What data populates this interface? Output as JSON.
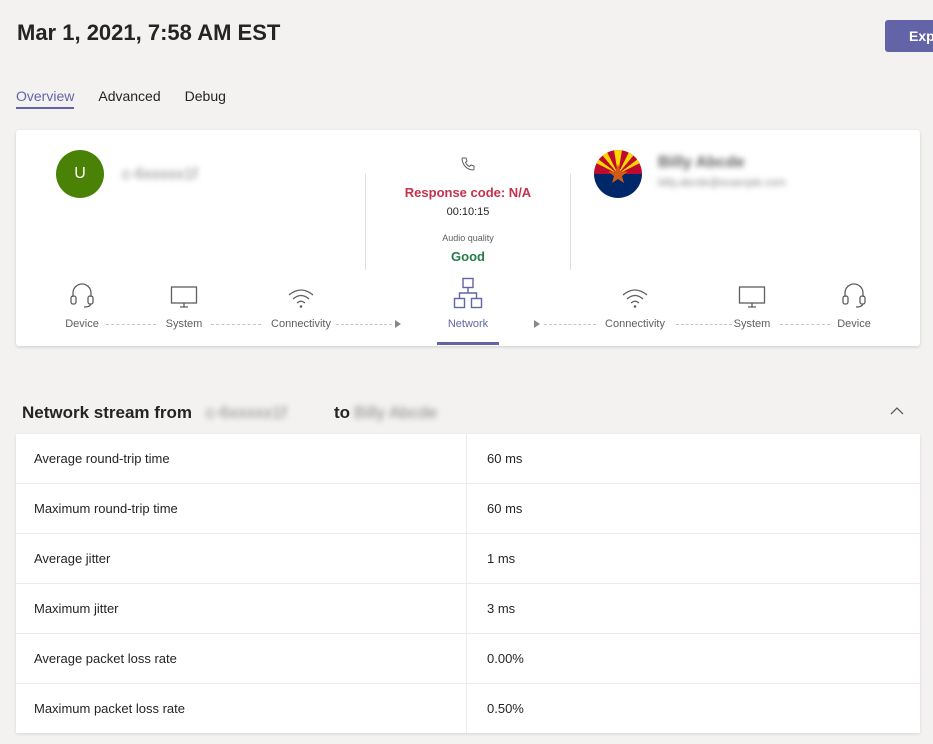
{
  "header": {
    "title": "Mar 1, 2021, 7:58 AM EST",
    "export_label": "Exp"
  },
  "tabs": [
    {
      "label": "Overview",
      "active": true
    },
    {
      "label": "Advanced",
      "active": false
    },
    {
      "label": "Debug",
      "active": false
    }
  ],
  "caller": {
    "initial": "U",
    "name": "c-6xxxxx1f"
  },
  "callee": {
    "name": "Billy Abcde",
    "email": "billy.abcde@example.com"
  },
  "call": {
    "response_code": "Response code: N/A",
    "duration": "00:10:15",
    "audio_quality_label": "Audio quality",
    "audio_quality": "Good"
  },
  "path_nodes": [
    {
      "label": "Device",
      "icon": "headset-icon"
    },
    {
      "label": "System",
      "icon": "monitor-icon"
    },
    {
      "label": "Connectivity",
      "icon": "wifi-icon"
    },
    {
      "label": "Network",
      "icon": "network-icon",
      "active": true
    },
    {
      "label": "Connectivity",
      "icon": "wifi-icon"
    },
    {
      "label": "System",
      "icon": "monitor-icon"
    },
    {
      "label": "Device",
      "icon": "headset-icon"
    }
  ],
  "stream": {
    "title_prefix": "Network stream from",
    "from": "c-6xxxxx1f",
    "to_word": "to",
    "to": "Billy Abcde"
  },
  "metrics": [
    {
      "label": "Average round-trip time",
      "value": "60 ms"
    },
    {
      "label": "Maximum round-trip time",
      "value": "60 ms"
    },
    {
      "label": "Average jitter",
      "value": "1 ms"
    },
    {
      "label": "Maximum jitter",
      "value": "3 ms"
    },
    {
      "label": "Average packet loss rate",
      "value": "0.00%"
    },
    {
      "label": "Maximum packet loss rate",
      "value": "0.50%"
    }
  ],
  "colors": {
    "accent": "#6264a7",
    "error": "#c4314b",
    "good": "#237b4b",
    "avatar": "#498205"
  }
}
